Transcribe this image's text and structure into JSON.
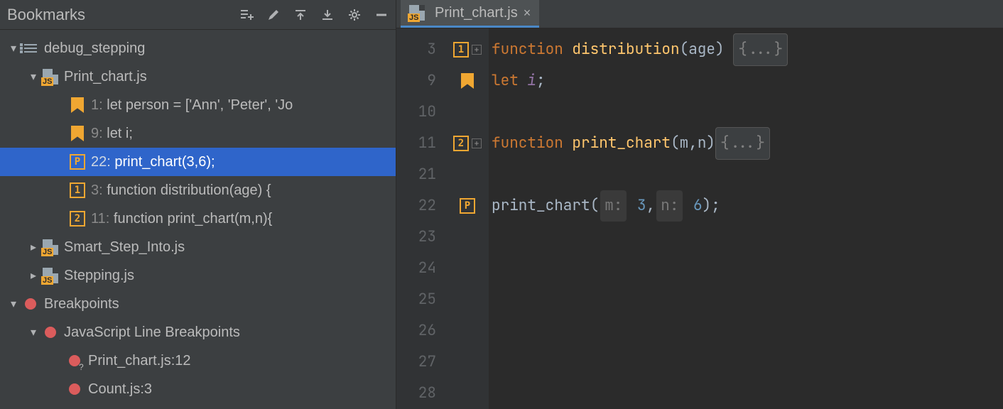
{
  "panel": {
    "title": "Bookmarks"
  },
  "tree": {
    "root": {
      "label": "debug_stepping"
    },
    "file1": {
      "label": "Print_chart.js"
    },
    "bm1": {
      "num": "1:",
      "text": " let person = ['Ann', 'Peter', 'Jo"
    },
    "bm2": {
      "num": "9:",
      "text": " let i;"
    },
    "bm3": {
      "mn": "P",
      "num": "22:",
      "text": " print_chart(3,6);"
    },
    "bm4": {
      "mn": "1",
      "num": "3:",
      "text": " function distribution(age) {"
    },
    "bm5": {
      "mn": "2",
      "num": "11:",
      "text": " function print_chart(m,n){"
    },
    "file2": {
      "label": "Smart_Step_Into.js"
    },
    "file3": {
      "label": "Stepping.js"
    },
    "bp_root": {
      "label": "Breakpoints"
    },
    "bp_cat": {
      "label": "JavaScript Line Breakpoints"
    },
    "bp1": {
      "label": "Print_chart.js:12"
    },
    "bp2": {
      "label": "Count.js:3"
    }
  },
  "tab": {
    "label": "Print_chart.js"
  },
  "gutter": {
    "l1": "3",
    "l2": "9",
    "l3": "10",
    "l4": "11",
    "l5": "21",
    "l6": "22",
    "l7": "23",
    "l8": "24",
    "l9": "25",
    "l10": "26",
    "l11": "27",
    "l12": "28"
  },
  "marks": {
    "m1": "1",
    "m4": "2",
    "m6": "P"
  },
  "code": {
    "r1_kw": "function ",
    "r1_fn": "distribution",
    "r1_args": "(age) ",
    "r1_fold": "{...}",
    "r2_kw": "let ",
    "r2_var": "i",
    "r2_semi": ";",
    "r4_kw": "function ",
    "r4_fn": "print_chart",
    "r4_args": "(m,n)",
    "r4_fold": "{...}",
    "r6_call": "print_chart(",
    "r6_h1": "m:",
    "r6_v1": " 3",
    "r6_comma": ",",
    "r6_h2": "n:",
    "r6_v2": " 6",
    "r6_close": ");"
  }
}
